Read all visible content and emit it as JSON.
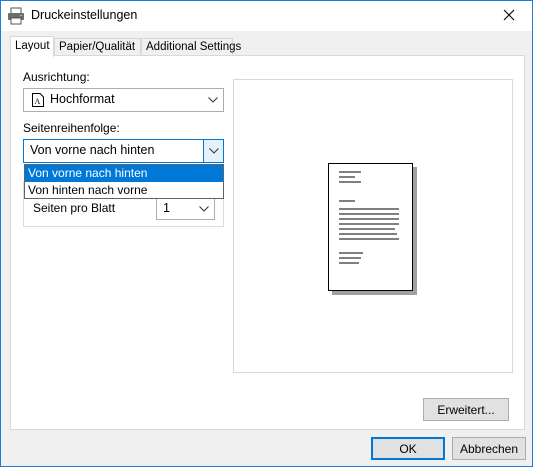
{
  "window": {
    "title": "Druckeinstellungen"
  },
  "tabs": [
    {
      "label": "Layout"
    },
    {
      "label": "Papier/Qualität"
    },
    {
      "label": "Additional Settings"
    }
  ],
  "layout": {
    "orientation_label": "Ausrichtung:",
    "orientation_value": "Hochformat",
    "page_order_label": "Seitenreihenfolge:",
    "page_order_value": "Von vorne nach hinten",
    "page_order_options": [
      "Von vorne nach hinten",
      "Von hinten nach vorne"
    ],
    "pages_per_sheet_label": "Seiten pro Blatt",
    "pages_per_sheet_value": "1"
  },
  "buttons": {
    "advanced": "Erweitert...",
    "ok": "OK",
    "cancel": "Abbrechen"
  },
  "colors": {
    "accent": "#0078d7",
    "close_hover": "#e81123"
  },
  "icons": [
    "printer-icon",
    "close-icon",
    "portrait-page-icon",
    "chevron-down-icon"
  ]
}
